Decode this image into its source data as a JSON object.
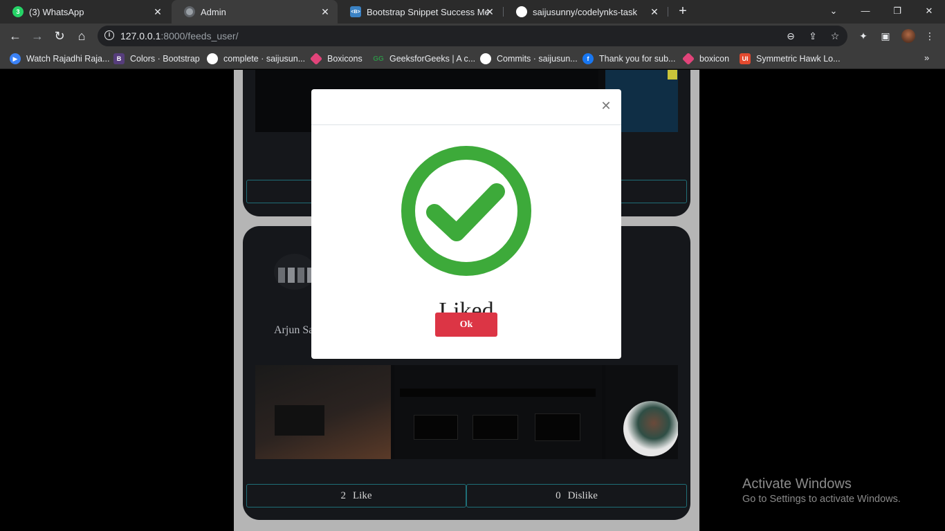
{
  "tabs": [
    {
      "title": "(3) WhatsApp",
      "favicon": "whatsapp-icon",
      "badge": "3",
      "color": "#25d366"
    },
    {
      "title": "Admin",
      "favicon": "globe-icon",
      "color": "#9aa0a6"
    },
    {
      "title": "Bootstrap Snippet Success Message",
      "favicon": "bootstrap-snippet-icon",
      "color": "#3b82c4"
    },
    {
      "title": "saijusunny/codelynks-task",
      "favicon": "github-icon",
      "color": "#ffffff"
    }
  ],
  "address_bar": {
    "host": "127.0.0.1",
    "path": ":8000/feeds_user/"
  },
  "bookmarks": [
    {
      "label": "Watch Rajadhi Raja...",
      "icon": "play-icon",
      "color": "#3b82f6"
    },
    {
      "label": "Colors · Bootstrap",
      "icon": "bootstrap-icon",
      "color": "#563d7c"
    },
    {
      "label": "complete · saijusun...",
      "icon": "github-icon",
      "color": "#ffffff"
    },
    {
      "label": "Boxicons",
      "icon": "boxicons-icon",
      "color": "#e1447a"
    },
    {
      "label": "GeeksforGeeks | A c...",
      "icon": "geeksforgeeks-icon",
      "color": "#2f8d46"
    },
    {
      "label": "Commits · saijusun...",
      "icon": "github-icon",
      "color": "#ffffff"
    },
    {
      "label": "Thank you for sub...",
      "icon": "facebook-icon",
      "color": "#1877f2"
    },
    {
      "label": "boxicon",
      "icon": "boxicons-icon",
      "color": "#e1447a"
    },
    {
      "label": "Symmetric Hawk Lo...",
      "icon": "ui-icon",
      "color": "#e34a2f"
    }
  ],
  "feed": {
    "card2": {
      "user_name": "Arjun Sa",
      "likes": "2",
      "like_label": "Like",
      "dislikes": "0",
      "dislike_label": "Dislike"
    }
  },
  "modal": {
    "title": "Liked",
    "ok_label": "Ok",
    "icon": "check-circle-icon",
    "icon_color": "#3daa3a",
    "button_color": "#dc3545"
  },
  "watermark": {
    "line1": "Activate Windows",
    "line2": "Go to Settings to activate Windows."
  }
}
